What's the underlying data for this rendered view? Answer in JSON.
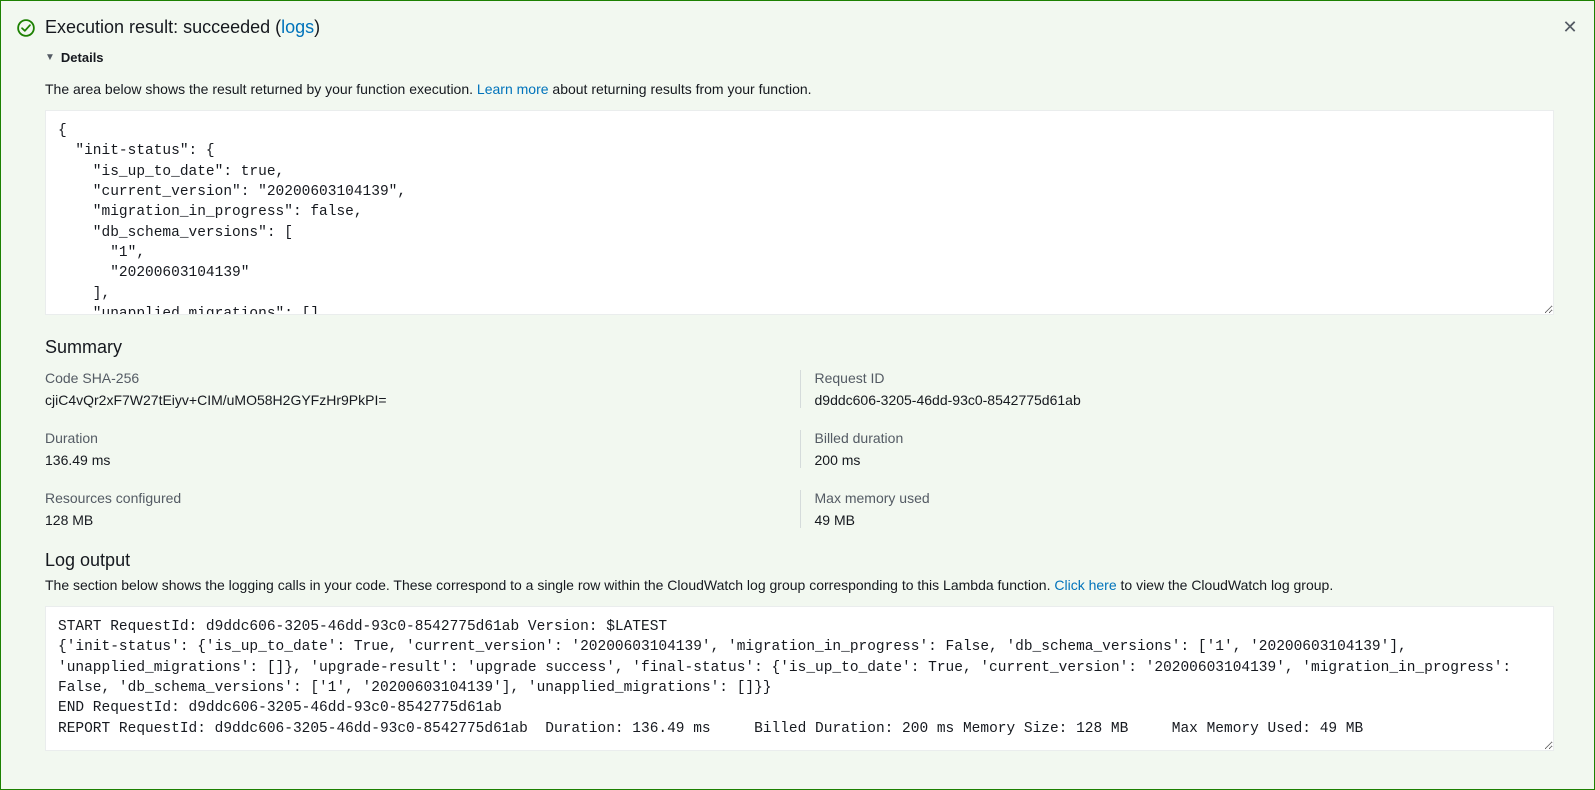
{
  "header": {
    "title_prefix": "Execution result: succeeded (",
    "logs_link": "logs",
    "title_suffix": ")"
  },
  "details": {
    "label": "Details"
  },
  "result": {
    "description_prefix": "The area below shows the result returned by your function execution. ",
    "learn_more": "Learn more",
    "description_suffix": " about returning results from your function.",
    "payload": "{\n  \"init-status\": {\n    \"is_up_to_date\": true,\n    \"current_version\": \"20200603104139\",\n    \"migration_in_progress\": false,\n    \"db_schema_versions\": [\n      \"1\",\n      \"20200603104139\"\n    ],\n    \"unapplied_migrations\": []"
  },
  "summary": {
    "heading": "Summary",
    "rows": [
      {
        "left_label": "Code SHA-256",
        "left_value": "cjiC4vQr2xF7W27tEiyv+CIM/uMO58H2GYFzHr9PkPI=",
        "right_label": "Request ID",
        "right_value": "d9ddc606-3205-46dd-93c0-8542775d61ab"
      },
      {
        "left_label": "Duration",
        "left_value": "136.49 ms",
        "right_label": "Billed duration",
        "right_value": "200 ms"
      },
      {
        "left_label": "Resources configured",
        "left_value": "128 MB",
        "right_label": "Max memory used",
        "right_value": "49 MB"
      }
    ]
  },
  "log": {
    "heading": "Log output",
    "description_prefix": "The section below shows the logging calls in your code. These correspond to a single row within the CloudWatch log group corresponding to this Lambda function. ",
    "click_here": "Click here",
    "description_suffix": " to view the CloudWatch log group.",
    "output": "START RequestId: d9ddc606-3205-46dd-93c0-8542775d61ab Version: $LATEST\n{'init-status': {'is_up_to_date': True, 'current_version': '20200603104139', 'migration_in_progress': False, 'db_schema_versions': ['1', '20200603104139'], 'unapplied_migrations': []}, 'upgrade-result': 'upgrade success', 'final-status': {'is_up_to_date': True, 'current_version': '20200603104139', 'migration_in_progress': False, 'db_schema_versions': ['1', '20200603104139'], 'unapplied_migrations': []}}\nEND RequestId: d9ddc606-3205-46dd-93c0-8542775d61ab\nREPORT RequestId: d9ddc606-3205-46dd-93c0-8542775d61ab\tDuration: 136.49 ms\tBilled Duration: 200 ms Memory Size: 128 MB\tMax Memory Used: 49 MB"
  }
}
